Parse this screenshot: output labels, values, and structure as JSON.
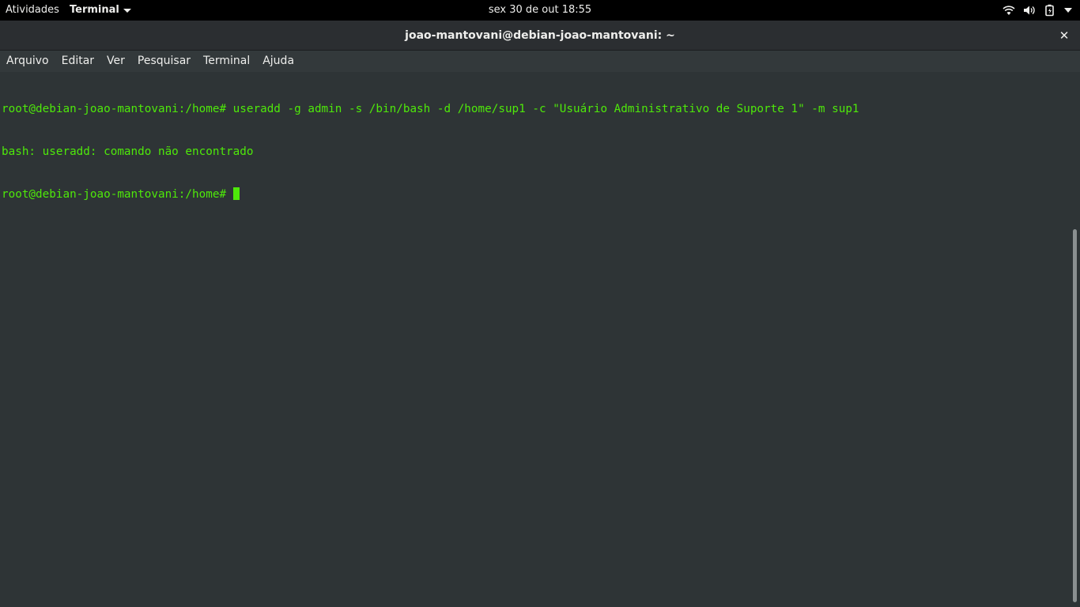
{
  "topbar": {
    "activities_label": "Atividades",
    "app_menu_label": "Terminal",
    "clock": "sex 30 de out  18:55",
    "tray_icons": [
      "wifi-icon",
      "volume-icon",
      "battery-icon",
      "system-menu-caret-icon"
    ]
  },
  "window": {
    "title": "joao-mantovani@debian-joao-mantovani: ~",
    "close_icon": "close-icon"
  },
  "menubar": {
    "items": [
      "Arquivo",
      "Editar",
      "Ver",
      "Pesquisar",
      "Terminal",
      "Ajuda"
    ]
  },
  "terminal": {
    "lines": [
      "root@debian-joao-mantovani:/home# useradd -g admin -s /bin/bash -d /home/sup1 -c \"Usuário Administrativo de Suporte 1\" -m sup1",
      "bash: useradd: comando não encontrado",
      "root@debian-joao-mantovani:/home# "
    ],
    "colors": {
      "text": "#4ee80a",
      "background": "#2e3436"
    }
  }
}
